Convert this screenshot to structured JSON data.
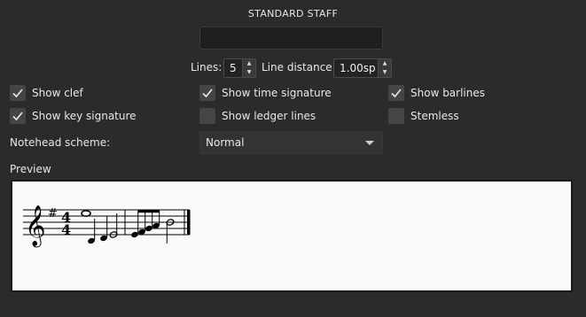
{
  "header": {
    "title": "STANDARD STAFF"
  },
  "name_field": {
    "value": ""
  },
  "lines": {
    "label": "Lines:",
    "value": "5"
  },
  "line_distance": {
    "label": "Line distance:",
    "value": "1.00sp"
  },
  "checkboxes": [
    {
      "label": "Show clef",
      "checked": true
    },
    {
      "label": "Show time signature",
      "checked": true
    },
    {
      "label": "Show barlines",
      "checked": true
    },
    {
      "label": "Show key signature",
      "checked": true
    },
    {
      "label": "Show ledger lines",
      "checked": false
    },
    {
      "label": "Stemless",
      "checked": false
    }
  ],
  "notehead_scheme": {
    "label": "Notehead scheme:",
    "value": "Normal"
  },
  "preview": {
    "label": "Preview",
    "time_signature": {
      "top": "4",
      "bottom": "4"
    },
    "key_signature": "#",
    "clef": "treble"
  },
  "colors": {
    "background": "#2b2b2b",
    "preview_bg": "#fafafa",
    "checkbox_bg": "#454545"
  },
  "icons": {
    "spin_up": "triangle-up-icon",
    "spin_down": "triangle-down-icon",
    "check": "check-icon",
    "dropdown": "chevron-down-icon"
  }
}
